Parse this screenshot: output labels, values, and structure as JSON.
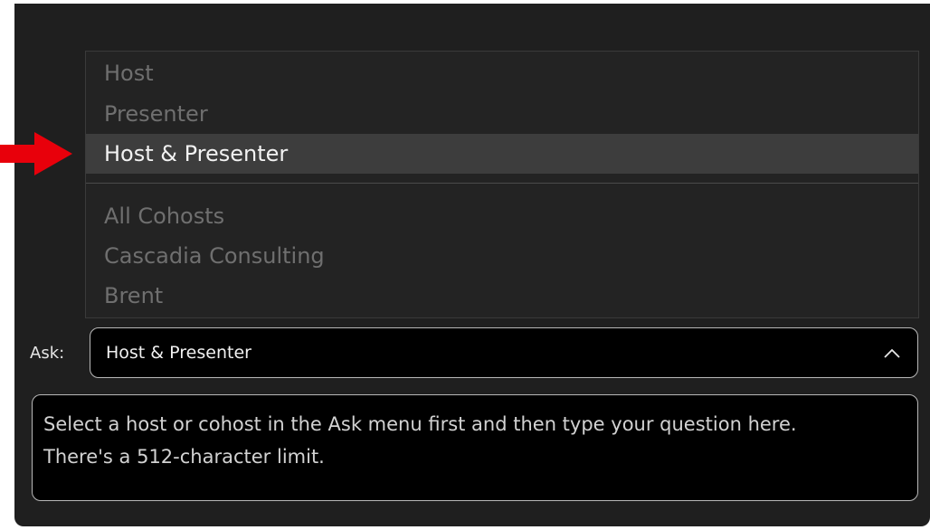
{
  "menu": {
    "items": [
      {
        "label": "Host",
        "selected": false
      },
      {
        "label": "Presenter",
        "selected": false
      },
      {
        "label": "Host & Presenter",
        "selected": true
      },
      {
        "label": "All Cohosts",
        "selected": false
      },
      {
        "label": "Cascadia Consulting",
        "selected": false
      },
      {
        "label": "Brent",
        "selected": false
      }
    ]
  },
  "ask": {
    "label": "Ask:",
    "selected_value": "Host & Presenter",
    "chevron_icon": "chevron-up-icon"
  },
  "question": {
    "placeholder": "Select a host or cohost in the Ask menu first and then type your question here. There's a 512-character limit."
  },
  "annotation": {
    "arrow_icon": "red-arrow-right-icon",
    "arrow_color": "#e8000b"
  },
  "colors": {
    "panel_bg": "#1f1f1f",
    "input_bg": "#000000",
    "highlight_bg": "#3d3d3d",
    "muted_text": "#6f6f6f"
  }
}
